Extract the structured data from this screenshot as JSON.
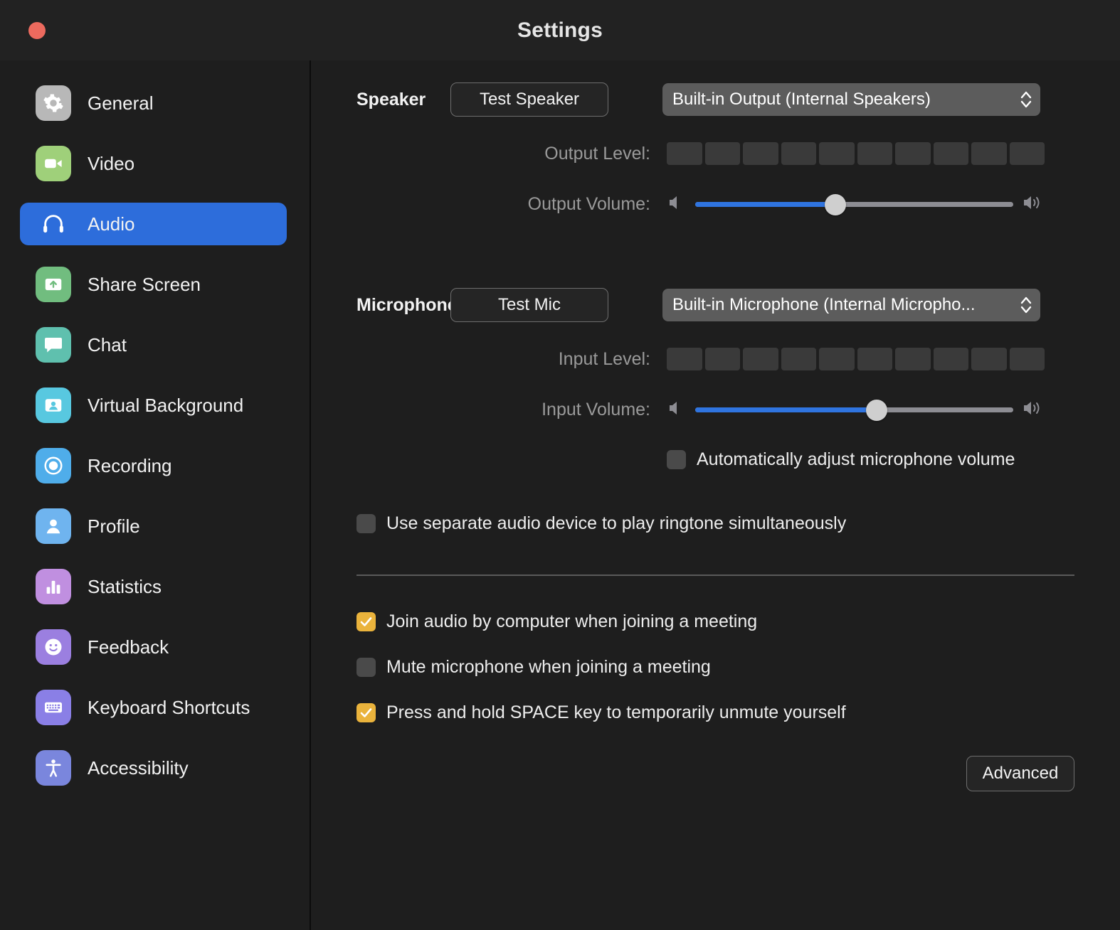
{
  "window": {
    "title": "Settings",
    "close_label": "Close",
    "accent_blue": "#2d6ddb",
    "checkbox_amber": "#eab33c",
    "slider_blue": "#2f74e0",
    "traffic_red": "#ec6a5e"
  },
  "sidebar": {
    "items": [
      {
        "label": "General",
        "icon": "gear-icon",
        "color": "#b8b8b8",
        "active": false
      },
      {
        "label": "Video",
        "icon": "video-camera-icon",
        "color": "#9fd07a",
        "active": false
      },
      {
        "label": "Audio",
        "icon": "headphones-icon",
        "color": "#2d6ddb",
        "active": true
      },
      {
        "label": "Share Screen",
        "icon": "share-screen-icon",
        "color": "#71bd7f",
        "active": false
      },
      {
        "label": "Chat",
        "icon": "chat-bubble-icon",
        "color": "#5fc0ae",
        "active": false
      },
      {
        "label": "Virtual Background",
        "icon": "virtual-background-icon",
        "color": "#58c8e0",
        "active": false
      },
      {
        "label": "Recording",
        "icon": "record-circle-icon",
        "color": "#4fadea",
        "active": false
      },
      {
        "label": "Profile",
        "icon": "person-icon",
        "color": "#6fb4ef",
        "active": false
      },
      {
        "label": "Statistics",
        "icon": "bar-chart-icon",
        "color": "#c08fe0",
        "active": false
      },
      {
        "label": "Feedback",
        "icon": "smiley-face-icon",
        "color": "#9b7fe0",
        "active": false
      },
      {
        "label": "Keyboard Shortcuts",
        "icon": "keyboard-icon",
        "color": "#8a7fe6",
        "active": false
      },
      {
        "label": "Accessibility",
        "icon": "accessibility-icon",
        "color": "#7a86dd",
        "active": false
      }
    ]
  },
  "speaker": {
    "section_label": "Speaker",
    "test_button": "Test Speaker",
    "device": "Built-in Output (Internal Speakers)",
    "output_level_label": "Output Level:",
    "output_level_segments": 10,
    "output_level_active": 0,
    "output_volume_label": "Output Volume:",
    "output_volume_percent": 44
  },
  "microphone": {
    "section_label": "Microphone",
    "test_button": "Test Mic",
    "device": "Built-in Microphone (Internal Micropho...",
    "input_level_label": "Input Level:",
    "input_level_segments": 10,
    "input_level_active": 0,
    "input_volume_label": "Input Volume:",
    "input_volume_percent": 57,
    "auto_adjust": {
      "label": "Automatically adjust microphone volume",
      "checked": false
    }
  },
  "options": {
    "separate_ringtone": {
      "label": "Use separate audio device to play ringtone simultaneously",
      "checked": false
    },
    "join_audio": {
      "label": "Join audio by computer when joining a meeting",
      "checked": true
    },
    "mute_mic": {
      "label": "Mute microphone when joining a meeting",
      "checked": false
    },
    "push_to_talk": {
      "label": "Press and hold SPACE key to temporarily unmute yourself",
      "checked": true
    }
  },
  "footer": {
    "advanced_button": "Advanced"
  }
}
